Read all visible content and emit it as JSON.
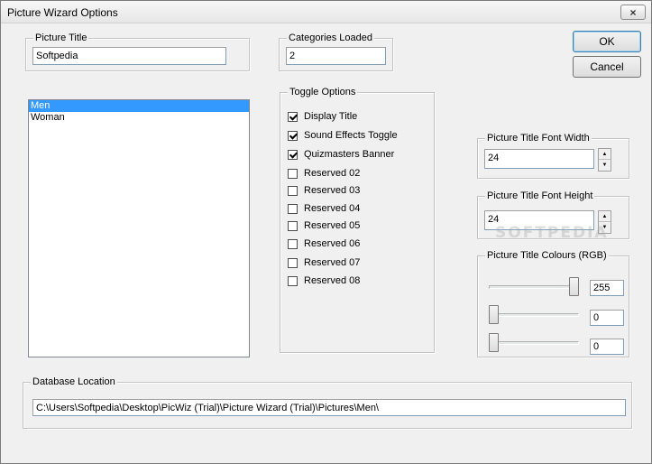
{
  "window": {
    "title": "Picture Wizard Options",
    "close_glyph": "×"
  },
  "picture_title": {
    "label": "Picture Title",
    "value": "Softpedia"
  },
  "categories_loaded": {
    "label": "Categories Loaded",
    "value": "2"
  },
  "category_list": {
    "items": [
      "Men",
      "Woman"
    ],
    "selected": "Men"
  },
  "toggle_options": {
    "label": "Toggle Options",
    "items": [
      {
        "label": "Display Title",
        "checked": true
      },
      {
        "label": "Sound Effects Toggle",
        "checked": true
      },
      {
        "label": "Quizmasters Banner",
        "checked": true
      },
      {
        "label": "Reserved 02",
        "checked": false
      },
      {
        "label": "Reserved 03",
        "checked": false
      },
      {
        "label": "Reserved 04",
        "checked": false
      },
      {
        "label": "Reserved 05",
        "checked": false
      },
      {
        "label": "Reserved 06",
        "checked": false
      },
      {
        "label": "Reserved 07",
        "checked": false
      },
      {
        "label": "Reserved 08",
        "checked": false
      }
    ]
  },
  "buttons": {
    "ok": "OK",
    "cancel": "Cancel"
  },
  "font_width": {
    "label": "Picture Title Font Width",
    "value": "24"
  },
  "font_height": {
    "label": "Picture Title Font Height",
    "value": "24"
  },
  "colours": {
    "label": "Picture Title Colours (RGB)",
    "red": "255",
    "green": "0",
    "blue": "0",
    "max": 255
  },
  "database": {
    "label": "Database Location",
    "path": "C:\\Users\\Softpedia\\Desktop\\PicWiz (Trial)\\Picture Wizard (Trial)\\Pictures\\Men\\"
  },
  "watermark": "SOFTPEDIA",
  "icons": {
    "spin_up": "spin-up-arrow-icon",
    "spin_down": "spin-down-arrow-icon",
    "close": "close-icon"
  }
}
